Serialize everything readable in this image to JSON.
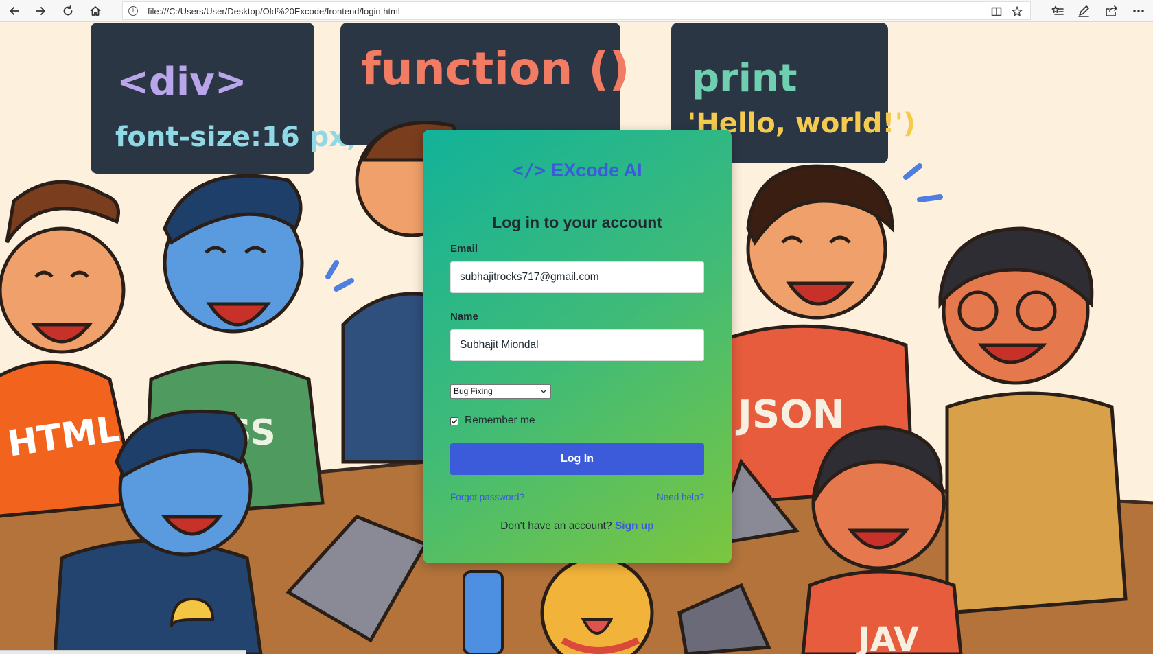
{
  "browser": {
    "url": "file:///C:/Users/User/Desktop/Old%20Excode/frontend/login.html"
  },
  "background": {
    "board_left_line1": "<div>",
    "board_left_line2": "font-size:16 px,",
    "board_center": "function ()",
    "board_right_line1": "print",
    "board_right_line2": "'Hello, world!')",
    "shirt_html": "HTML",
    "shirt_css": "CSS",
    "shirt_json": "JSON",
    "shirt_java": "JAV"
  },
  "login": {
    "brand_icon": "</>",
    "brand_name": "EXcode AI",
    "title": "Log in to your account",
    "email_label": "Email",
    "email_value": "subhajitrocks717@gmail.com",
    "name_label": "Name",
    "name_value": "Subhajit Miondal",
    "topic_selected": "Bug Fixing",
    "remember_label": "Remember me",
    "remember_checked": true,
    "login_button": "Log In",
    "forgot_link": "Forgot password?",
    "help_link": "Need help?",
    "signup_prompt": "Don't have an account?",
    "signup_link": "Sign up"
  },
  "colors": {
    "accent": "#3b5bdb",
    "card_gradient_start": "#12b29a",
    "card_gradient_end": "#7cc63e"
  }
}
